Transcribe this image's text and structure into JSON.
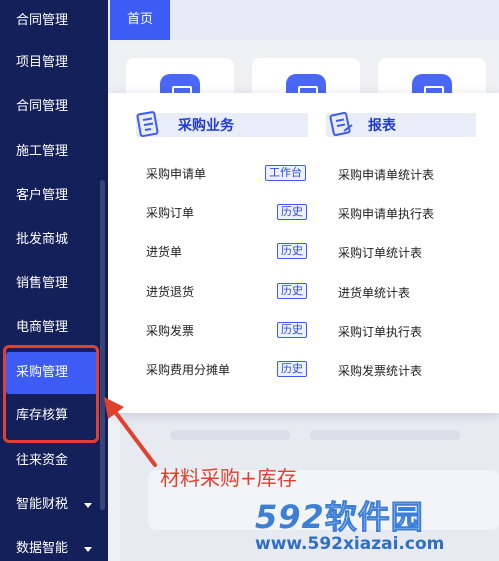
{
  "sidebar": {
    "items": [
      {
        "label": "合同管理"
      },
      {
        "label": "项目管理"
      },
      {
        "label": "合同管理"
      },
      {
        "label": "施工管理"
      },
      {
        "label": "客户管理"
      },
      {
        "label": "批发商城"
      },
      {
        "label": "销售管理"
      },
      {
        "label": "电商管理"
      },
      {
        "label": "采购管理",
        "active": true
      },
      {
        "label": "库存核算"
      },
      {
        "label": "往来资金"
      },
      {
        "label": "智能财税",
        "caret": true
      },
      {
        "label": "数据智能",
        "caret": true
      }
    ]
  },
  "tabs": {
    "home": "首页"
  },
  "dropdown": {
    "purchase": {
      "title": "采购业务",
      "icon": "document-list-icon",
      "items": [
        {
          "label": "采购申请单",
          "tag": "工作台"
        },
        {
          "label": "采购订单",
          "tag": "历史"
        },
        {
          "label": "进货单",
          "tag": "历史"
        },
        {
          "label": "进货退货",
          "tag": "历史"
        },
        {
          "label": "采购发票",
          "tag": "历史"
        },
        {
          "label": "采购费用分摊单",
          "tag": "历史"
        }
      ]
    },
    "reports": {
      "title": "报表",
      "icon": "report-icon",
      "items": [
        {
          "label": "采购申请单统计表"
        },
        {
          "label": "采购申请单执行表"
        },
        {
          "label": "采购订单统计表"
        },
        {
          "label": "进货单统计表"
        },
        {
          "label": "采购订单执行表"
        },
        {
          "label": "采购发票统计表"
        }
      ]
    }
  },
  "annotation": {
    "text": "材料采购+库存"
  },
  "watermark": {
    "logo_num": "592",
    "logo_cn": "软件园",
    "url": "www.592xiazai.com"
  },
  "colors": {
    "sidebar": "#14205a",
    "accent": "#3d5cf6",
    "annotation": "#e0402d",
    "watermark": "#3e7fd6"
  }
}
